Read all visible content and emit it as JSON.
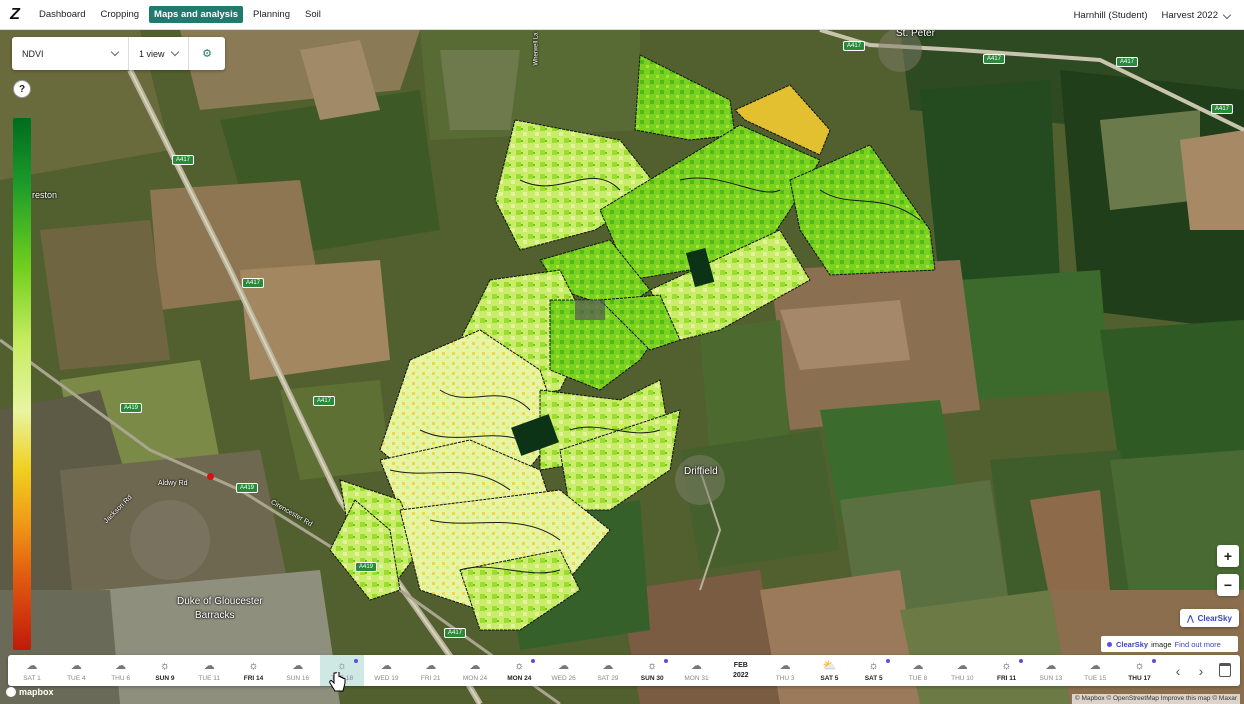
{
  "app": {
    "logo": "Z"
  },
  "nav": {
    "items": [
      {
        "label": "Dashboard",
        "active": false
      },
      {
        "label": "Cropping",
        "active": false
      },
      {
        "label": "Maps and analysis",
        "active": true
      },
      {
        "label": "Planning",
        "active": false
      },
      {
        "label": "Soil",
        "active": false
      }
    ],
    "farm": "Harnhill (Student)",
    "season": "Harvest 2022"
  },
  "layer": {
    "selected": "NDVI",
    "views": "1 view",
    "settings_icon": "gear-icon"
  },
  "help": "?",
  "map": {
    "places": [
      "St. Peter",
      "Driffield",
      "Duke of Gloucester",
      "Barracks",
      "reston",
      "Aldwy Rd",
      "Cirencester Rd",
      "Jackson Rd",
      "Wherwell La"
    ],
    "roads": [
      "A417",
      "A417",
      "A417",
      "A417",
      "A417",
      "A417",
      "A417",
      "A417",
      "A419",
      "A419",
      "A419"
    ]
  },
  "legend": {
    "scale": "NDVI",
    "colors": [
      "#006b1f",
      "#6fcf1e",
      "#e8f5a0",
      "#f0d020",
      "#c01a0a"
    ]
  },
  "controls": {
    "zoom_in": "+",
    "zoom_out": "−"
  },
  "clearsky": {
    "button": "ClearSky",
    "note_brand": "ClearSky",
    "note_text": "image",
    "note_link": "Find out more"
  },
  "timeline": {
    "days": [
      {
        "label": "SAT 1",
        "icon": "cloud",
        "bold": false,
        "dot": false
      },
      {
        "label": "TUE 4",
        "icon": "cloud",
        "bold": false,
        "dot": false
      },
      {
        "label": "THU 6",
        "icon": "cloud",
        "bold": false,
        "dot": false
      },
      {
        "label": "SUN 9",
        "icon": "sun",
        "bold": true,
        "dot": false
      },
      {
        "label": "TUE 11",
        "icon": "cloud",
        "bold": false,
        "dot": false
      },
      {
        "label": "FRI 14",
        "icon": "sun",
        "bold": true,
        "dot": false
      },
      {
        "label": "SUN 16",
        "icon": "cloud",
        "bold": false,
        "dot": false
      },
      {
        "label": "TUE 18",
        "icon": "sun",
        "bold": false,
        "dot": true,
        "selected": true
      },
      {
        "label": "WED 19",
        "icon": "cloud",
        "bold": false,
        "dot": false
      },
      {
        "label": "FRI 21",
        "icon": "cloud",
        "bold": false,
        "dot": false
      },
      {
        "label": "MON 24",
        "icon": "cloud",
        "bold": false,
        "dot": false
      },
      {
        "label": "MON 24",
        "icon": "sun",
        "bold": true,
        "dot": true
      },
      {
        "label": "WED 26",
        "icon": "cloud",
        "bold": false,
        "dot": false
      },
      {
        "label": "SAT 29",
        "icon": "cloud",
        "bold": false,
        "dot": false
      },
      {
        "label": "SUN 30",
        "icon": "sun",
        "bold": true,
        "dot": true
      },
      {
        "label": "MON 31",
        "icon": "cloud",
        "bold": false,
        "dot": false
      },
      {
        "label": "FEB 2022",
        "month": true
      },
      {
        "label": "THU 3",
        "icon": "cloud",
        "bold": false,
        "dot": false
      },
      {
        "label": "SAT 5",
        "icon": "partly",
        "bold": true,
        "dot": false
      },
      {
        "label": "SAT 5",
        "icon": "sun",
        "bold": true,
        "dot": true
      },
      {
        "label": "TUE 8",
        "icon": "cloud",
        "bold": false,
        "dot": false
      },
      {
        "label": "THU 10",
        "icon": "cloud",
        "bold": false,
        "dot": false
      },
      {
        "label": "FRI 11",
        "icon": "sun",
        "bold": true,
        "dot": true
      },
      {
        "label": "SUN 13",
        "icon": "cloud",
        "bold": false,
        "dot": false
      },
      {
        "label": "TUE 15",
        "icon": "cloud",
        "bold": false,
        "dot": false
      },
      {
        "label": "THU 17",
        "icon": "sun",
        "bold": true,
        "dot": true
      }
    ],
    "month_top": "FEB",
    "month_bottom": "2022"
  },
  "attribution": {
    "logo": "mapbox",
    "text": "© Mapbox © OpenStreetMap Improve this map © Maxar"
  }
}
